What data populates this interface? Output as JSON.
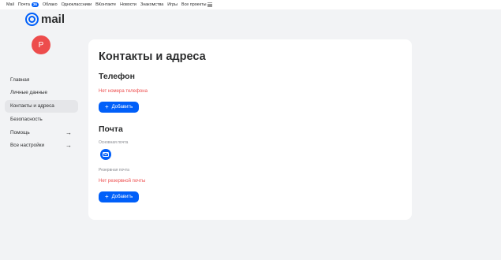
{
  "topbar": {
    "items": [
      "Mail",
      "Почта",
      "Облако",
      "Одноклассники",
      "ВКонтакте",
      "Новости",
      "Знакомства",
      "Игры",
      "Все проекты"
    ],
    "mail_badge": "36"
  },
  "brand": {
    "logo_text": "mail"
  },
  "user": {
    "avatar_letter": "P",
    "avatar_color": "#ed4c4c"
  },
  "sidebar": {
    "items": [
      {
        "label": "Главная"
      },
      {
        "label": "Личные данные"
      },
      {
        "label": "Контакты и адреса"
      },
      {
        "label": "Безопасность"
      },
      {
        "label": "Помощь",
        "arrow": "→"
      },
      {
        "label": "Все настройки",
        "arrow": "→"
      }
    ]
  },
  "main": {
    "title": "Контакты и адреса",
    "phone": {
      "title": "Телефон",
      "empty_text": "Нет номера телефона",
      "add_label": "Добавить"
    },
    "email": {
      "title": "Почта",
      "primary_label": "Основная почта",
      "backup_label": "Резервная почта",
      "backup_empty": "Нет резервной почты",
      "add_label": "Добавить"
    }
  },
  "colors": {
    "accent": "#005ff9",
    "error": "#ed4c4c",
    "background": "#f2f3f5",
    "active_item": "#e5e6e9"
  }
}
